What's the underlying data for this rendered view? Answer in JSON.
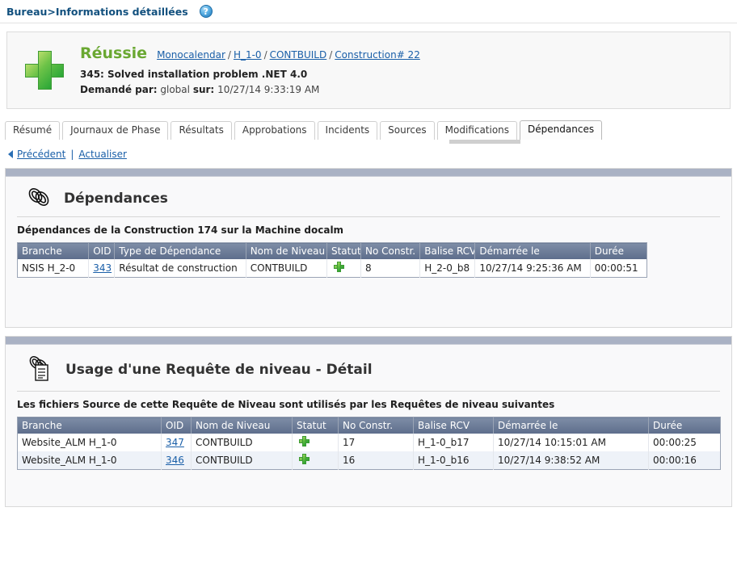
{
  "topbar": {
    "breadcrumb": "Bureau>Informations détaillées",
    "help_icon_label": "?"
  },
  "summary": {
    "status": "Réussie",
    "status_color": "#6aa832",
    "status_icon": "green-plus-icon",
    "breadcrumb_links": [
      "Monocalendar",
      "H_1-0",
      "CONTBUILD",
      "Construction# 22"
    ],
    "separator": "/",
    "description": "345: Solved installation problem .NET 4.0",
    "requested_by_label": "Demandé par:",
    "requested_by_value": "global",
    "on_label": "sur:",
    "on_value": "10/27/14 9:33:19 AM"
  },
  "tabs": [
    {
      "label": "Résumé",
      "active": false
    },
    {
      "label": "Journaux de Phase",
      "active": false
    },
    {
      "label": "Résultats",
      "active": false
    },
    {
      "label": "Approbations",
      "active": false
    },
    {
      "label": "Incidents",
      "active": false
    },
    {
      "label": "Sources",
      "active": false
    },
    {
      "label": "Modifications",
      "active": false
    },
    {
      "label": "Dépendances",
      "active": true
    }
  ],
  "navlinks": {
    "back": "Précédent",
    "divider": "|",
    "refresh": "Actualiser"
  },
  "section1": {
    "icon": "chain-link-icon",
    "title": "Dépendances",
    "subtitle": "Dépendances de la Construction 174 sur la Machine docalm",
    "table": {
      "columns": [
        "Branche",
        "OID",
        "Type de Dépendance",
        "Nom de Niveau",
        "Statut",
        "No Constr.",
        "Balise RCV",
        "Démarrée le",
        "Durée"
      ],
      "rows": [
        {
          "branche": "NSIS H_2-0",
          "oid": "343",
          "type": "Résultat de construction",
          "niveau": "CONTBUILD",
          "statut": "green-plus-icon",
          "no_constr": "8",
          "balise": "H_2-0_b8",
          "demarree": "10/27/14 9:25:36 AM",
          "duree": "00:00:51"
        }
      ]
    }
  },
  "section2": {
    "icon": "chain-link-document-icon",
    "title": "Usage d'une Requête de niveau - Détail",
    "subtitle": "Les fichiers Source de cette Requête de Niveau sont utilisés par les Requêtes de niveau suivantes",
    "table": {
      "columns": [
        "Branche",
        "OID",
        "Nom de Niveau",
        "Statut",
        "No Constr.",
        "Balise RCV",
        "Démarrée le",
        "Durée"
      ],
      "rows": [
        {
          "branche": "Website_ALM H_1-0",
          "oid": "347",
          "niveau": "CONTBUILD",
          "statut": "green-plus-icon",
          "no_constr": "17",
          "balise": "H_1-0_b17",
          "demarree": "10/27/14 10:15:01 AM",
          "duree": "00:00:25"
        },
        {
          "branche": "Website_ALM H_1-0",
          "oid": "346",
          "niveau": "CONTBUILD",
          "statut": "green-plus-icon",
          "no_constr": "16",
          "balise": "H_1-0_b16",
          "demarree": "10/27/14 9:38:52 AM",
          "duree": "00:00:16"
        }
      ]
    }
  },
  "colors": {
    "link": "#1a5fa8",
    "header_blue": "#12507e",
    "table_header": "#5d6d8b",
    "panel_bar": "#aab2c4",
    "success_green": "#6aa832"
  }
}
